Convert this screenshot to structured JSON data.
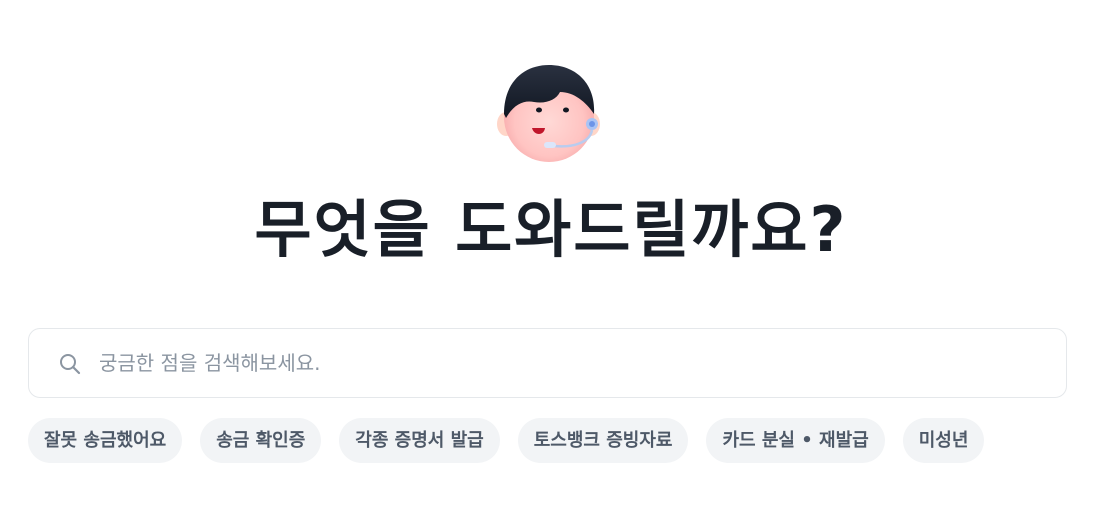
{
  "avatar": {
    "icon": "support-agent-avatar-icon"
  },
  "title": "무엇을 도와드릴까요?",
  "search": {
    "icon": "search-icon",
    "placeholder": "궁금한 점을 검색해보세요.",
    "value": ""
  },
  "chips": [
    "잘못 송금했어요",
    "송금 확인증",
    "각종 증명서 발급",
    "토스뱅크 증빙자료",
    "카드 분실 • 재발급",
    "미성년"
  ],
  "colors": {
    "title": "#191f28",
    "chip_bg": "#f2f4f6",
    "chip_text": "#4e5968",
    "placeholder": "#8b95a1",
    "border": "#e5e8eb"
  }
}
